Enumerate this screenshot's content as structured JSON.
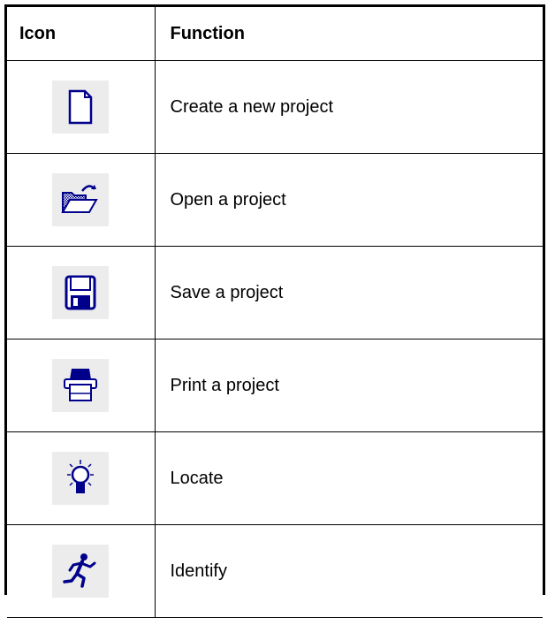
{
  "table": {
    "headers": {
      "icon": "Icon",
      "function": "Function"
    },
    "rows": [
      {
        "icon": "new-document-icon",
        "function": "Create a new project"
      },
      {
        "icon": "open-folder-icon",
        "function": "Open a project"
      },
      {
        "icon": "floppy-disk-icon",
        "function": "Save a project"
      },
      {
        "icon": "printer-icon",
        "function": "Print a project"
      },
      {
        "icon": "light-bulb-icon",
        "function": "Locate"
      },
      {
        "icon": "running-man-icon",
        "function": "Identify"
      }
    ]
  },
  "colors": {
    "icon_blue": "#00008b",
    "icon_background": "#ececec",
    "border": "#000000"
  }
}
